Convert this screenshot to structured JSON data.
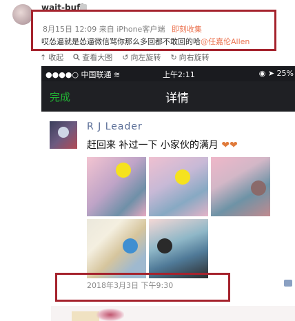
{
  "outer_post": {
    "username": "wait-buff",
    "date": "8月15日 12:09",
    "source": "来自 iPhone客户端",
    "source_link": "即刻收集",
    "text": "哎怂逼就是怂逼微信骂你那么多回都不敢回的哈",
    "mention": "@任嘉伦Allen"
  },
  "toolbar": {
    "items": [
      "收起",
      "查看大图",
      "向左旋转",
      "向右旋转"
    ]
  },
  "phone": {
    "status_left": "●●●●○ 中国联通",
    "time": "上午2:11",
    "battery": "25%",
    "nav_done": "完成",
    "nav_title": "详情",
    "moment_name": "R J Leader",
    "moment_text": "赶回来 补过一下 小家伙的满月",
    "moment_emoji": "❤❤",
    "timestamp": "2018年3月3日 下午9:30"
  },
  "colors": {
    "highlight_box": "#a5232d",
    "link": "#eb7350",
    "wechat_name": "#576b95",
    "wechat_green": "#22b735"
  }
}
